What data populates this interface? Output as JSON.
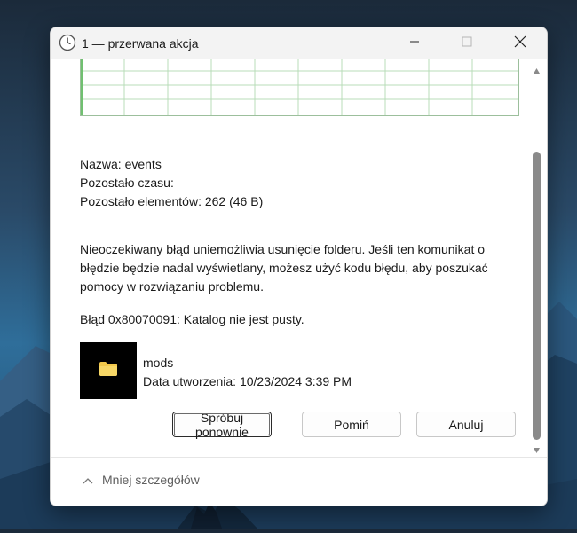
{
  "window": {
    "title": "1 — przerwana akcja",
    "controls": {
      "minimize": "minimize-icon",
      "maximize": "maximize-icon",
      "close": "close-icon"
    }
  },
  "details": {
    "name_label": "Nazwa:",
    "name_value": "events",
    "time_left_label": "Pozostało czasu:",
    "time_left_value": "",
    "items_left_label": "Pozostało elementów:",
    "items_left_value": "262 (46 B)"
  },
  "error": {
    "message": "Nieoczekiwany błąd uniemożliwia usunięcie folderu. Jeśli ten komunikat o błędzie będzie nadal wyświetlany, możesz użyć kodu błędu, aby poszukać pomocy w rozwiązaniu problemu.",
    "code_line": "Błąd 0x80070091: Katalog nie jest pusty."
  },
  "item": {
    "icon": "folder-icon",
    "name": "mods",
    "created": "Data utworzenia: 10/23/2024 3:39 PM"
  },
  "buttons": {
    "retry": "Spróbuj ponownie",
    "skip": "Pomiń",
    "cancel": "Anuluj"
  },
  "footer": {
    "toggle_label": "Mniej szczegółów"
  },
  "colors": {
    "graph_grid": "#b9dcb9",
    "graph_progress": "#70c070",
    "folder": "#f2c84b"
  }
}
